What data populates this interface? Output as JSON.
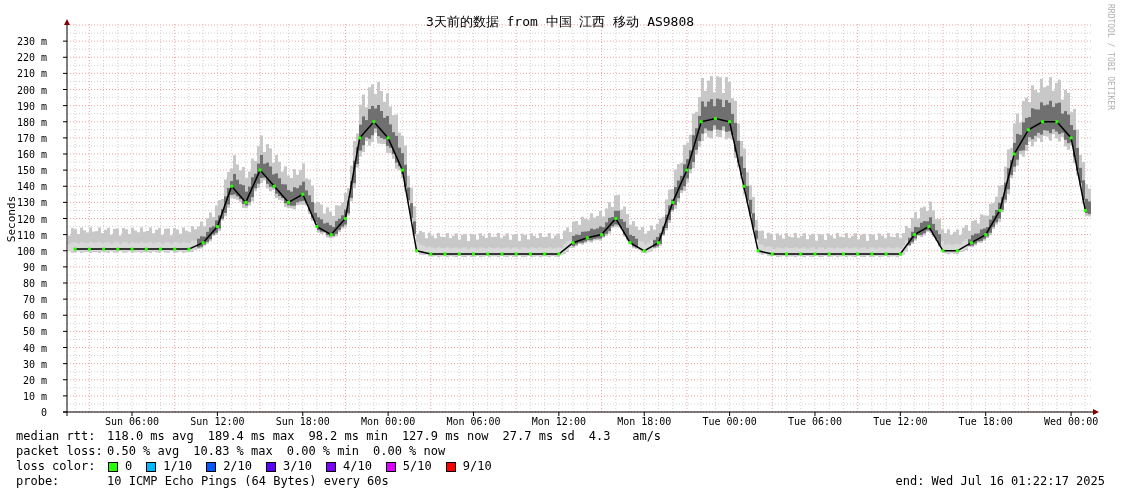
{
  "chart": {
    "chart_data": {
      "type": "line",
      "title": "3天前的数据 from 中国 江西 移动 AS9808",
      "ylabel": "Seconds",
      "categories": [
        null,
        null,
        null,
        null,
        "Sun 06:00",
        null,
        null,
        null,
        null,
        null,
        "Sun 12:00",
        null,
        null,
        null,
        null,
        null,
        "Sun 18:00",
        null,
        null,
        null,
        null,
        null,
        "Mon 00:00",
        null,
        null,
        null,
        null,
        null,
        "Mon 06:00",
        null,
        null,
        null,
        null,
        null,
        "Mon 12:00",
        null,
        null,
        null,
        null,
        null,
        "Mon 18:00",
        null,
        null,
        null,
        null,
        null,
        "Tue 00:00",
        null,
        null,
        null,
        null,
        null,
        "Tue 06:00",
        null,
        null,
        null,
        null,
        null,
        "Tue 12:00",
        null,
        null,
        null,
        null,
        null,
        "Tue 18:00",
        null,
        null,
        null,
        null,
        null,
        "Wed 00:00",
        null
      ],
      "grid": true,
      "series": [
        {
          "color": "#000000",
          "marker": "square",
          "values": [
            101,
            101,
            101,
            101,
            101,
            101,
            101,
            101,
            101,
            105,
            115,
            140,
            130,
            150,
            140,
            130,
            135,
            115,
            110,
            120,
            170,
            180,
            170,
            150,
            100,
            98,
            98,
            98,
            98,
            98,
            98,
            98,
            98,
            98,
            98,
            105,
            108,
            110,
            120,
            105,
            100,
            105,
            130,
            150,
            180,
            182,
            180,
            140,
            100,
            98,
            98,
            98,
            98,
            98,
            98,
            98,
            98,
            98,
            98,
            110,
            115,
            100,
            100,
            105,
            110,
            125,
            160,
            175,
            180,
            180,
            170,
            125
          ]
        }
      ],
      "ylim": [
        0,
        240
      ],
      "yticks": [
        {
          "value": 0,
          "label": "0"
        },
        {
          "value": 10,
          "label": "10 m"
        },
        {
          "value": 20,
          "label": "20 m"
        },
        {
          "value": 30,
          "label": "30 m"
        },
        {
          "value": 40,
          "label": "40 m"
        },
        {
          "value": 50,
          "label": "50 m"
        },
        {
          "value": 60,
          "label": "60 m"
        },
        {
          "value": 70,
          "label": "70 m"
        },
        {
          "value": 80,
          "label": "80 m"
        },
        {
          "value": 90,
          "label": "90 m"
        },
        {
          "value": 100,
          "label": "100 m"
        },
        {
          "value": 110,
          "label": "110 m"
        },
        {
          "value": 120,
          "label": "120 m"
        },
        {
          "value": 130,
          "label": "130 m"
        },
        {
          "value": 140,
          "label": "140 m"
        },
        {
          "value": 150,
          "label": "150 m"
        },
        {
          "value": 160,
          "label": "160 m"
        },
        {
          "value": 170,
          "label": "170 m"
        },
        {
          "value": 180,
          "label": "180 m"
        },
        {
          "value": 190,
          "label": "190 m"
        },
        {
          "value": 200,
          "label": "200 m"
        },
        {
          "value": 210,
          "label": "210 m"
        },
        {
          "value": 220,
          "label": "220 m"
        },
        {
          "value": 230,
          "label": "230 m"
        }
      ]
    },
    "credit": "RRDTOOL / TOBI OETIKER"
  },
  "legend": {
    "median_rtt": {
      "label": "median rtt:",
      "stats": [
        "118.0 ms avg",
        "189.4 ms max",
        "98.2 ms min",
        "127.9 ms now",
        "27.7 ms sd",
        "4.3   am/s"
      ]
    },
    "packet_loss": {
      "label": "packet loss:",
      "stats": [
        "0.50 % avg",
        "10.83 % max",
        "0.00 % min",
        "0.00 % now"
      ]
    },
    "loss_color": {
      "label": "loss color:",
      "items": [
        {
          "label": "0",
          "color": "#26ff00"
        },
        {
          "label": "1/10",
          "color": "#00b8ff"
        },
        {
          "label": "2/10",
          "color": "#0059ff"
        },
        {
          "label": "3/10",
          "color": "#5e00ff"
        },
        {
          "label": "4/10",
          "color": "#7e00ff"
        },
        {
          "label": "5/10",
          "color": "#dd00ff"
        },
        {
          "label": "9/10",
          "color": "#ff0000"
        }
      ]
    },
    "probe": {
      "label": "probe:",
      "text": "10 ICMP Echo Pings (64 Bytes) every 60s"
    },
    "end": "end: Wed Jul 16 01:22:17 2025"
  }
}
